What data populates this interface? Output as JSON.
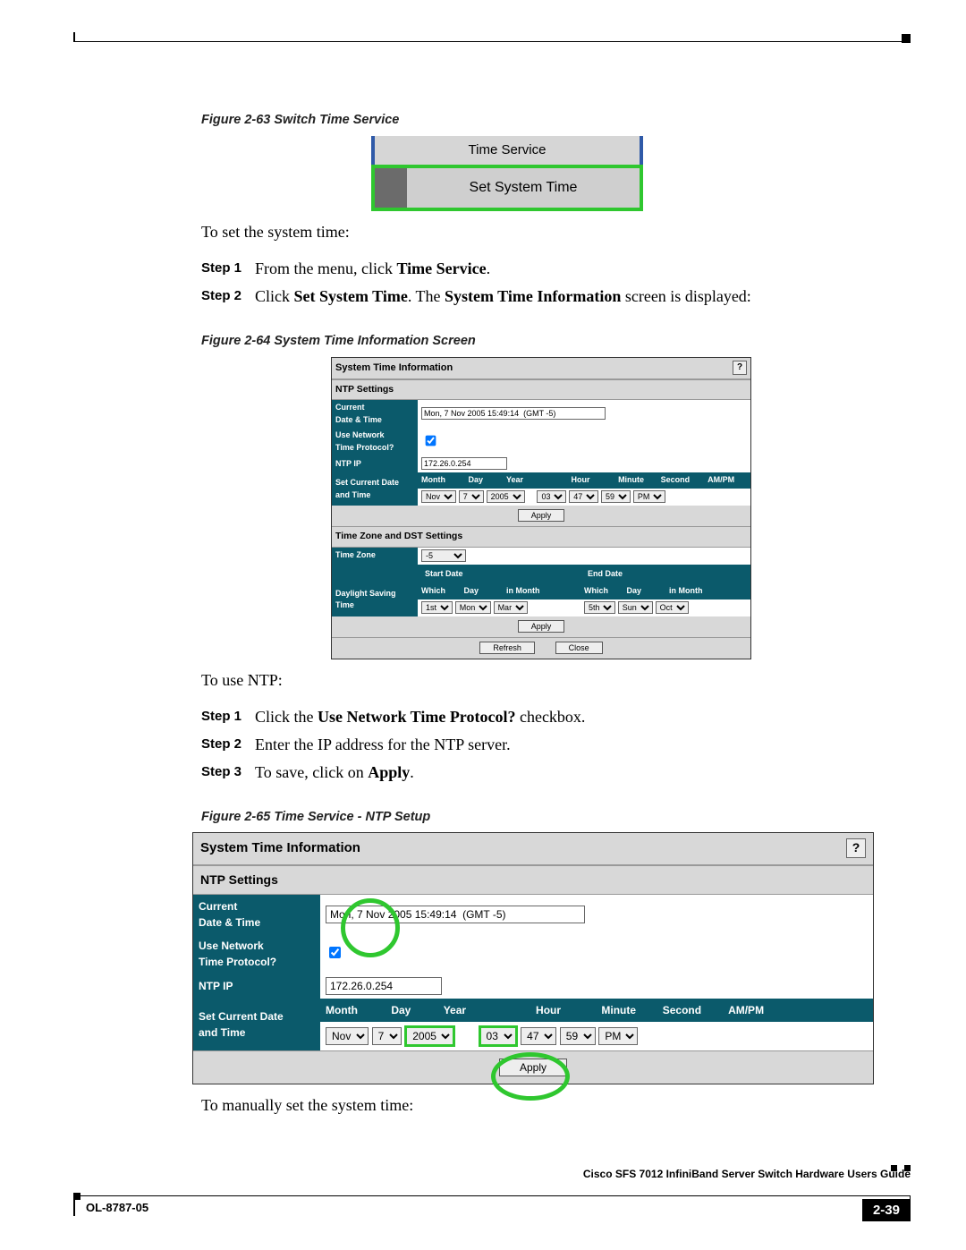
{
  "figure63": {
    "caption": "Figure 2-63   Switch Time Service",
    "menu_header": "Time Service",
    "menu_item": "Set System Time"
  },
  "text": {
    "intro_set": "To set the system time:",
    "intro_ntp": "To use NTP:",
    "intro_manual": "To manually set the system time:"
  },
  "steps_a": [
    {
      "label": "Step 1",
      "pre": "From the menu, click ",
      "bold": "Time Service",
      "post": "."
    },
    {
      "label": "Step 2",
      "pre": "Click ",
      "bold": "Set System Time",
      "mid": ". The ",
      "bold2": "System Time Information",
      "post": " screen is displayed:"
    }
  ],
  "figure64": {
    "caption": "Figure 2-64   System Time Information Screen",
    "title": "System Time Information",
    "section_ntp": "NTP Settings",
    "labels": {
      "current": "Current\nDate & Time",
      "use_ntp": "Use Network\nTime Protocol?",
      "ntp_ip": "NTP IP",
      "set_current": "Set Current Date\nand Time",
      "tz": "Time Zone",
      "dst": "Daylight Saving\nTime"
    },
    "current_value": "Mon, 7 Nov 2005 15:49:14  (GMT -5)",
    "ntp_checked": true,
    "ntp_ip": "172.26.0.254",
    "date_headers": [
      "Month",
      "Day",
      "Year",
      "Hour",
      "Minute",
      "Second",
      "AM/PM"
    ],
    "date_values": [
      "Nov",
      "7",
      "2005",
      "03",
      "47",
      "59",
      "PM"
    ],
    "section_tz": "Time Zone and DST Settings",
    "tz_value": "-5",
    "start_head": "Start Date",
    "end_head": "End Date",
    "dst_headers": [
      "Which",
      "Day",
      "in Month"
    ],
    "dst_start": [
      "1st",
      "Mon",
      "Mar"
    ],
    "dst_end": [
      "5th",
      "Sun",
      "Oct"
    ],
    "btn_apply": "Apply",
    "btn_refresh": "Refresh",
    "btn_close": "Close"
  },
  "steps_b": [
    {
      "label": "Step 1",
      "pre": "Click the ",
      "bold": "Use Network Time Protocol?",
      "post": " checkbox."
    },
    {
      "label": "Step 2",
      "pre": "Enter the IP address for the NTP server.",
      "bold": "",
      "post": ""
    },
    {
      "label": "Step 3",
      "pre": "To save, click on ",
      "bold": "Apply",
      "post": "."
    }
  ],
  "figure65": {
    "caption": "Figure 2-65   Time Service - NTP Setup",
    "title": "System Time Information",
    "section_ntp": "NTP Settings",
    "labels": {
      "current": "Current\nDate & Time",
      "use_ntp": "Use Network\nTime Protocol?",
      "ntp_ip": "NTP IP",
      "set_current": "Set Current Date\nand Time"
    },
    "current_value": "Mon, 7 Nov 2005 15:49:14  (GMT -5)",
    "ntp_checked": true,
    "ntp_ip": "172.26.0.254",
    "date_headers": [
      "Month",
      "Day",
      "Year",
      "Hour",
      "Minute",
      "Second",
      "AM/PM"
    ],
    "date_values": [
      "Nov",
      "7",
      "2005",
      "03",
      "47",
      "59",
      "PM"
    ],
    "btn_apply": "Apply"
  },
  "footer": {
    "guide": "Cisco SFS 7012 InfiniBand Server Switch Hardware Users Guide",
    "doc": "OL-8787-05",
    "page": "2-39"
  }
}
